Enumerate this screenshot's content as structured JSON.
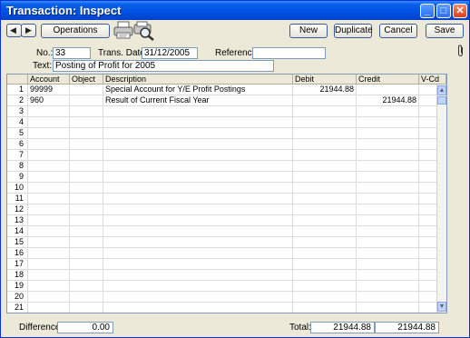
{
  "window": {
    "title": "Transaction: Inspect",
    "controls": {
      "minimize": "_",
      "maximize": "□",
      "close": "✕"
    }
  },
  "toolbar": {
    "prev_icon": "◀",
    "next_icon": "▶",
    "operations_label": "Operations",
    "new_label": "New",
    "duplicate_label": "Duplicate",
    "cancel_label": "Cancel",
    "save_label": "Save"
  },
  "header": {
    "no_label": "No.:",
    "no_value": "33",
    "trans_date_label": "Trans. Date:",
    "trans_date_value": "31/12/2005",
    "reference_label": "Reference:",
    "reference_value": "",
    "text_label": "Text:",
    "text_value": "Posting of Profit for 2005"
  },
  "grid": {
    "columns": [
      "Account",
      "Object",
      "Description",
      "Debit",
      "Credit",
      "V-Cd"
    ],
    "rows": [
      {
        "n": "1",
        "account": "99999",
        "object": "",
        "description": "Special Account for Y/E Profit Postings",
        "debit": "21944.88",
        "credit": "",
        "vcd": ""
      },
      {
        "n": "2",
        "account": "960",
        "object": "",
        "description": "Result of Current Fiscal Year",
        "debit": "",
        "credit": "21944.88",
        "vcd": ""
      },
      {
        "n": "3"
      },
      {
        "n": "4"
      },
      {
        "n": "5"
      },
      {
        "n": "6"
      },
      {
        "n": "7"
      },
      {
        "n": "8"
      },
      {
        "n": "9"
      },
      {
        "n": "10"
      },
      {
        "n": "11"
      },
      {
        "n": "12"
      },
      {
        "n": "13"
      },
      {
        "n": "14"
      },
      {
        "n": "15"
      },
      {
        "n": "16"
      },
      {
        "n": "17"
      },
      {
        "n": "18"
      },
      {
        "n": "19"
      },
      {
        "n": "20"
      },
      {
        "n": "21"
      }
    ]
  },
  "footer": {
    "difference_label": "Difference:",
    "difference_value": "0.00",
    "total_label": "Total:",
    "total_debit": "21944.88",
    "total_credit": "21944.88"
  },
  "icons": {
    "printer": "printer-icon",
    "preview": "print-preview-icon",
    "attachment": "paperclip-icon"
  }
}
